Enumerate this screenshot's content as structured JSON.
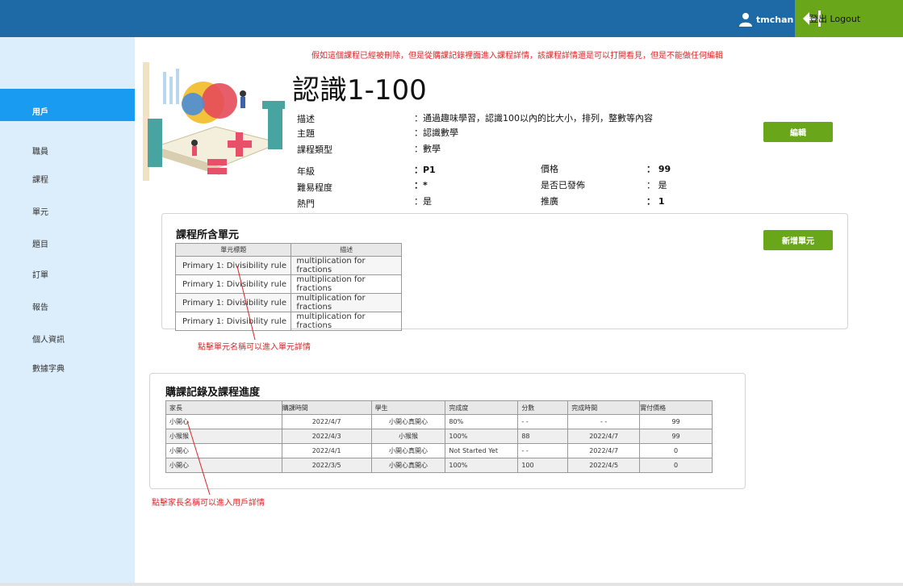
{
  "header": {
    "username": "tmchan",
    "logout_label": "登出 Logout",
    "colors": {
      "topbar": "#1e6aa6",
      "logout": "#6aa619"
    }
  },
  "sidebar": {
    "items": [
      "用戶",
      "職員",
      "課程",
      "單元",
      "題目",
      "訂單",
      "報告",
      "個人資訊",
      "數據字典"
    ]
  },
  "notes": {
    "deleted": "假如這個課程已經被刪除，但是從購課記錄裡面進入課程詳情，該課程詳情還是可以打開看見，但是不能做任何編輯",
    "unit_hint": "點擊單元名稱可以進入單元詳情",
    "parent_hint": "點擊家長名稱可以進入用戶詳情"
  },
  "course": {
    "title": "認識1-100",
    "fields": {
      "desc_label": "描述",
      "desc_value": "：通過趣味學習，認識100以內的比大小，排列，整數等內容",
      "topic_label": "主題",
      "topic_value": "：認識數學",
      "type_label": "課程類型",
      "type_value": "：數學",
      "grade_label": "年級",
      "grade_value": "：P1",
      "difficulty_label": "難易程度",
      "difficulty_value": "：*",
      "hot_label": "熱門",
      "hot_value": "：是",
      "price_label": "價格",
      "price_value": "： 99",
      "published_label": "是否已發佈",
      "published_value": "： 是",
      "promo_label": "推廣",
      "promo_value": "： 1"
    },
    "edit_label": "編輯"
  },
  "units": {
    "title": "課程所含單元",
    "add_label": "新增單元",
    "headers": [
      "單元標題",
      "描述"
    ],
    "rows": [
      [
        "Primary 1: Divisibility rule",
        "multiplication for fractions"
      ],
      [
        "Primary 1: Divisibility rule",
        "multiplication for fractions"
      ],
      [
        "Primary 1: Divisibility rule",
        "multiplication for fractions"
      ],
      [
        "Primary 1: Divisibility rule",
        "multiplication for fractions"
      ]
    ]
  },
  "orders": {
    "title": "購課記錄及課程進度",
    "headers": [
      "家長",
      "購課時間",
      "學生",
      "完成度",
      "分數",
      "完成時間",
      "實付價格"
    ],
    "rows": [
      [
        "小開心",
        "2022/4/7",
        "小開心真開心",
        "80%",
        "- -",
        "- -",
        "99"
      ],
      [
        "小猴猴",
        "2022/4/3",
        "小猴猴",
        "100%",
        "88",
        "2022/4/7",
        "99"
      ],
      [
        "小開心",
        "2022/4/1",
        "小開心真開心",
        "Not Started Yet",
        "- -",
        "2022/4/7",
        "0"
      ],
      [
        "小開心",
        "2022/3/5",
        "小開心真開心",
        "100%",
        "100",
        "2022/4/5",
        "0"
      ]
    ]
  }
}
